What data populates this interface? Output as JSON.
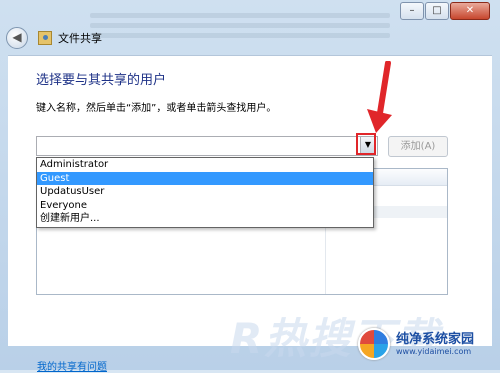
{
  "window": {
    "title": "文件共享",
    "controls": {
      "minimize": "–",
      "maximize": "□",
      "close": "✕"
    }
  },
  "main": {
    "heading": "选择要与其共享的用户",
    "instruction": "键入名称，然后单击“添加”，或者单击箭头查找用户。",
    "combo_value": "",
    "add_button": "添加(A)",
    "dropdown_options": [
      "Administrator",
      "Guest",
      "UpdatusUser",
      "Everyone",
      "创建新用户..."
    ],
    "selected_option": "Guest"
  },
  "footer": {
    "help_link": "我的共享有问题"
  },
  "watermark": {
    "big": "R热搜下载",
    "brand": "纯净系统家园",
    "url": "www.yidaimei.com"
  },
  "icons": {
    "back": "back-arrow-icon",
    "title": "file-sharing-icon",
    "dropdown": "chevron-down-icon"
  },
  "colors": {
    "heading": "#1e3287",
    "selection": "#3399ff",
    "annotation": "#e0262a",
    "link": "#0066cc"
  }
}
